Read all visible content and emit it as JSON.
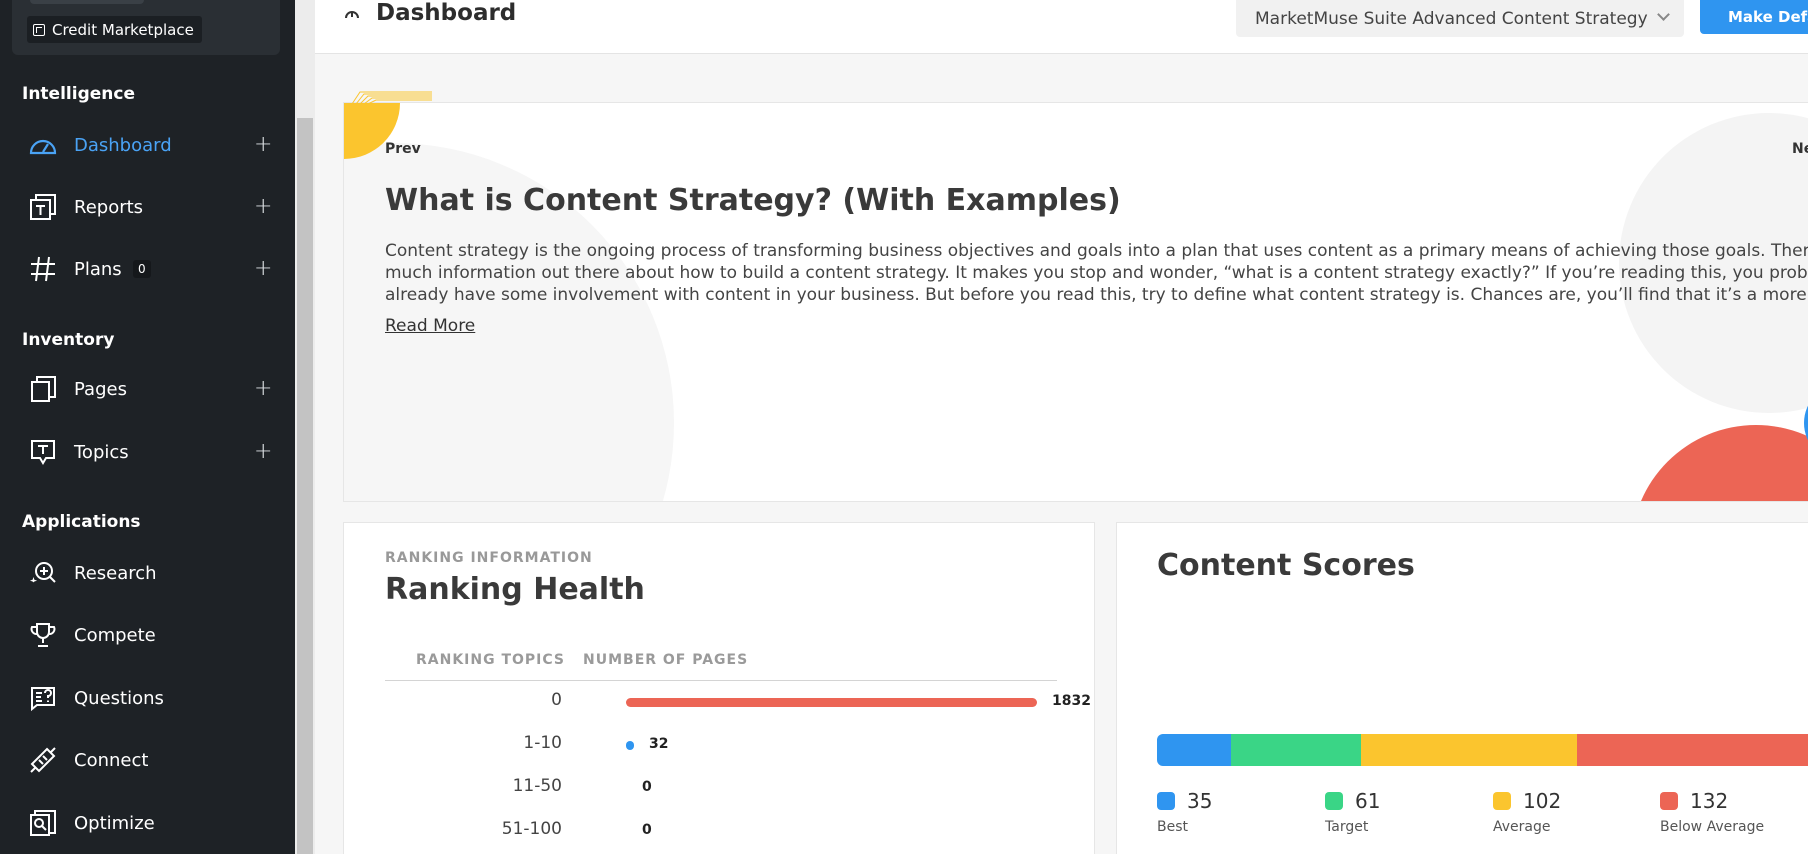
{
  "sidebar": {
    "credit_marketplace": "Credit Marketplace",
    "sections": [
      {
        "title": "Intelligence"
      },
      {
        "title": "Inventory"
      },
      {
        "title": "Applications"
      }
    ],
    "items": [
      {
        "label": "Dashboard",
        "icon": "gauge-icon"
      },
      {
        "label": "Reports",
        "icon": "report-icon"
      },
      {
        "label": "Plans",
        "icon": "hash-icon",
        "count": "0"
      },
      {
        "label": "Pages",
        "icon": "pages-icon"
      },
      {
        "label": "Topics",
        "icon": "topic-icon"
      },
      {
        "label": "Research",
        "icon": "research-icon"
      },
      {
        "label": "Compete",
        "icon": "trophy-icon"
      },
      {
        "label": "Questions",
        "icon": "questions-icon"
      },
      {
        "label": "Connect",
        "icon": "connect-icon"
      },
      {
        "label": "Optimize",
        "icon": "optimize-icon"
      }
    ],
    "plus": "+"
  },
  "header": {
    "title": "Dashboard",
    "select_value": "MarketMuse Suite Advanced Content Strategy",
    "make_default": "Make Default"
  },
  "hero": {
    "prev": "Prev",
    "next": "Next",
    "title": "What is Content Strategy? (With Examples)",
    "body": "Content strategy is the ongoing process of transforming business objectives and goals into a plan that uses content as a primary means of achieving those goals.  There’s so much information out there about how to build a content strategy. It makes you stop and wonder, “what is a content strategy exactly?” If you’re reading this, you probably already have some involvement with content in your business. But before you read this, try to define what content strategy is. Chances are, you’ll find that it’s a more slippery",
    "read_more": "Read More"
  },
  "ranking": {
    "eyebrow": "RANKING INFORMATION",
    "title": "Ranking Health",
    "col_topics": "RANKING TOPICS",
    "col_pages": "NUMBER OF PAGES",
    "rows": [
      {
        "label": "0",
        "value": "1832",
        "color": "#ec6555"
      },
      {
        "label": "1-10",
        "value": "32",
        "color": "#2f95f0"
      },
      {
        "label": "11-50",
        "value": "0",
        "color": "#2f95f0"
      },
      {
        "label": "51-100",
        "value": "0",
        "color": "#2f95f0"
      }
    ]
  },
  "scores": {
    "title": "Content Scores",
    "items": [
      {
        "value": "35",
        "label": "Best",
        "color": "#2f95f0"
      },
      {
        "value": "61",
        "label": "Target",
        "color": "#3ad586"
      },
      {
        "value": "102",
        "label": "Average",
        "color": "#fbc52e"
      },
      {
        "value": "132",
        "label": "Below Average",
        "color": "#ec6555"
      }
    ]
  },
  "colors": {
    "accent": "#2f95f0",
    "sidebar_bg": "#1e2226",
    "active_nav": "#4aa3f5"
  }
}
